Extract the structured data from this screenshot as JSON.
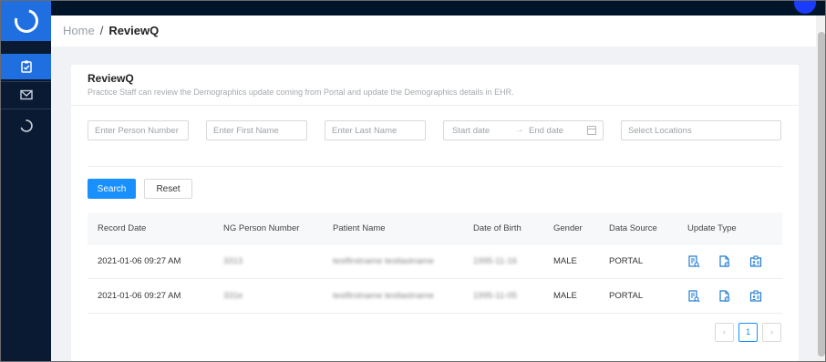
{
  "colors": {
    "sidebar_bg": "#0b1a33",
    "accent": "#1f6fe0",
    "primary_button": "#1890ff",
    "action_icon": "#1e7bd0"
  },
  "sidebar": {
    "logo_icon": "logo-ring-icon",
    "items": [
      {
        "icon": "clipboard-check-icon",
        "active": true
      },
      {
        "icon": "mail-icon",
        "active": false
      },
      {
        "icon": "loading-spinner-icon",
        "active": false
      }
    ]
  },
  "breadcrumb": {
    "home": "Home",
    "separator": "/",
    "current": "ReviewQ"
  },
  "card": {
    "title": "ReviewQ",
    "description": "Practice Staff can review the Demographics update coming from Portal and update the Demographics details in EHR."
  },
  "filters": {
    "person_number_placeholder": "Enter Person Number",
    "first_name_placeholder": "Enter First Name",
    "last_name_placeholder": "Enter Last Name",
    "start_date_placeholder": "Start date",
    "range_arrow": "→",
    "end_date_placeholder": "End date",
    "locations_placeholder": "Select Locations"
  },
  "buttons": {
    "search": "Search",
    "reset": "Reset"
  },
  "table": {
    "columns": {
      "record_date": "Record Date",
      "ng_person_number": "NG Person Number",
      "patient_name": "Patient Name",
      "date_of_birth": "Date of Birth",
      "gender": "Gender",
      "data_source": "Data Source",
      "update_type": "Update Type"
    },
    "rows": [
      {
        "record_date": "2021-01-06 09:27 AM",
        "ng_person_number": "3313",
        "patient_name": "testfirstname testlastname",
        "date_of_birth": "1995-11-16",
        "gender": "MALE",
        "data_source": "PORTAL",
        "update_icons": [
          "document-review-icon",
          "document-settings-icon",
          "id-card-icon"
        ]
      },
      {
        "record_date": "2021-01-06 09:27 AM",
        "ng_person_number": "331e",
        "patient_name": "testfirstname testlastname",
        "date_of_birth": "1995-11-05",
        "gender": "MALE",
        "data_source": "PORTAL",
        "update_icons": [
          "document-review-icon",
          "document-settings-icon",
          "id-card-icon"
        ]
      }
    ]
  },
  "pagination": {
    "prev": "‹",
    "current_page": "1",
    "next": "›"
  }
}
